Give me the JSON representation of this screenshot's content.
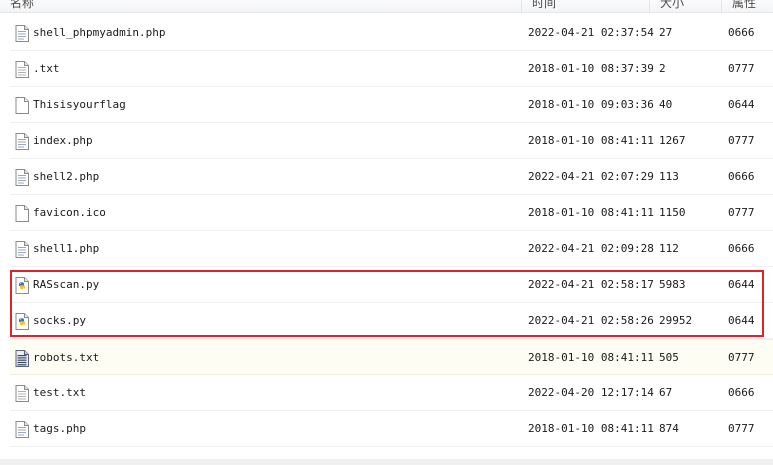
{
  "columns": {
    "name": "名称",
    "time": "时间",
    "size": "大小",
    "attr": "属性"
  },
  "files": [
    {
      "name": "shell_phpmyadmin.php",
      "time": "2022-04-21 02:37:54",
      "size": "27",
      "attr": "0666",
      "icon": "php-file-icon"
    },
    {
      "name": ".txt",
      "time": "2018-01-10 08:37:39",
      "size": "2",
      "attr": "0777",
      "icon": "text-file-icon"
    },
    {
      "name": "Thisisyourflag",
      "time": "2018-01-10 09:03:36",
      "size": "40",
      "attr": "0644",
      "icon": "blank-file-icon"
    },
    {
      "name": "index.php",
      "time": "2018-01-10 08:41:11",
      "size": "1267",
      "attr": "0777",
      "icon": "php-file-icon"
    },
    {
      "name": "shell2.php",
      "time": "2022-04-21 02:07:29",
      "size": "113",
      "attr": "0666",
      "icon": "php-file-icon"
    },
    {
      "name": "favicon.ico",
      "time": "2018-01-10 08:41:11",
      "size": "1150",
      "attr": "0777",
      "icon": "blank-file-icon"
    },
    {
      "name": "shell1.php",
      "time": "2022-04-21 02:09:28",
      "size": "112",
      "attr": "0666",
      "icon": "php-file-icon"
    },
    {
      "name": "RASscan.py",
      "time": "2022-04-21 02:58:17",
      "size": "5983",
      "attr": "0644",
      "icon": "python-file-icon"
    },
    {
      "name": "socks.py",
      "time": "2022-04-21 02:58:26",
      "size": "29952",
      "attr": "0644",
      "icon": "python-file-icon"
    },
    {
      "name": "robots.txt",
      "time": "2018-01-10 08:41:11",
      "size": "505",
      "attr": "0777",
      "icon": "text-file-dark-icon"
    },
    {
      "name": "test.txt",
      "time": "2022-04-20 12:17:14",
      "size": "67",
      "attr": "0666",
      "icon": "text-file-icon"
    },
    {
      "name": "tags.php",
      "time": "2018-01-10 08:41:11",
      "size": "874",
      "attr": "0777",
      "icon": "php-file-icon"
    }
  ],
  "highlight_color": "#d9262e",
  "hover_row_index": 9
}
